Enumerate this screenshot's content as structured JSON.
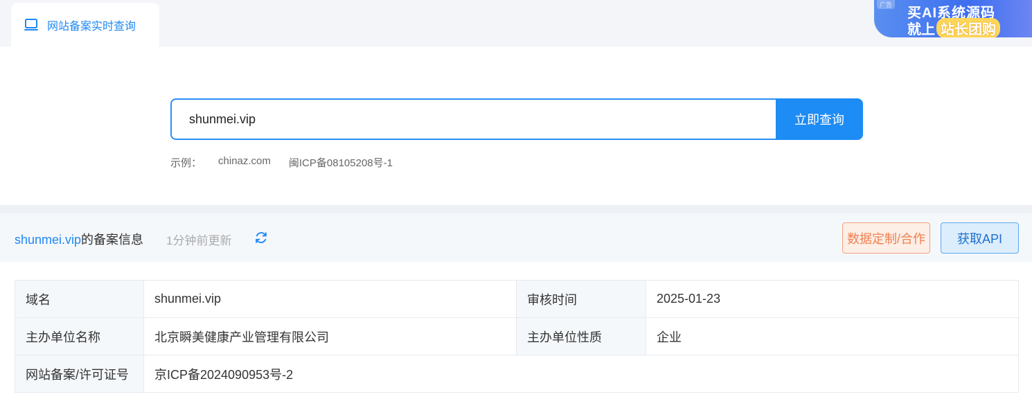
{
  "tab": {
    "label": "网站备案实时查询",
    "icon": "laptop-icon"
  },
  "ad": {
    "tag": "广告",
    "line1": "买AI系统源码",
    "line2_prefix": "就上",
    "line2_highlight": "站长团购"
  },
  "search": {
    "value": "shunmei.vip",
    "button_label": "立即查询"
  },
  "examples": {
    "label": "示例：",
    "items": [
      "chinaz.com",
      "闽ICP备08105208号-1"
    ]
  },
  "result_header": {
    "domain": "shunmei.vip",
    "suffix": "的备案信息",
    "updated": "1分钟前更新",
    "refresh_icon": "refresh-icon",
    "custom_button": "数据定制/合作",
    "api_button": "获取API"
  },
  "table": {
    "rows": [
      {
        "k1": "域名",
        "v1": "shunmei.vip",
        "k2": "审核时间",
        "v2": "2025-01-23"
      },
      {
        "k1": "主办单位名称",
        "v1": "北京瞬美健康产业管理有限公司",
        "k2": "主办单位性质",
        "v2": "企业"
      },
      {
        "k1": "网站备案/许可证号",
        "v1": "京ICP备2024090953号-2"
      }
    ]
  },
  "colors": {
    "accent": "#1e8cf5",
    "orange": "#f0804f"
  }
}
